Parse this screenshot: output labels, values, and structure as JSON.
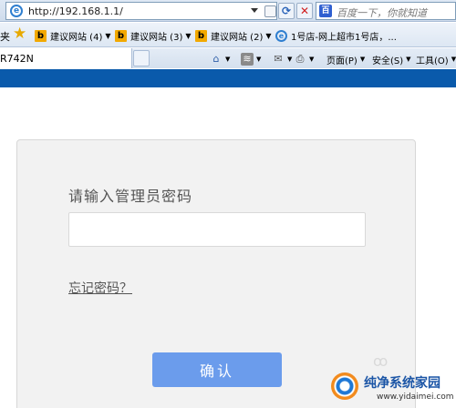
{
  "browser": {
    "address": "http://192.168.1.1/",
    "search_placeholder": "百度一下，你就知道",
    "favorites_cut_text": "夹",
    "favorites": [
      {
        "label": "建议网站 (4)",
        "icon": "b-icon"
      },
      {
        "label": "建议网站 (3)",
        "icon": "b-icon"
      },
      {
        "label": "建议网站 (2)",
        "icon": "b-icon"
      },
      {
        "label": "1号店-网上超市1号店，...",
        "icon": "ie-icon"
      }
    ],
    "tab_label": "R742N",
    "commands": {
      "page": "页面(P)",
      "safety": "安全(S)",
      "tools": "工具(O)"
    }
  },
  "login": {
    "title": "请输入管理员密码",
    "password_value": "",
    "forgot_label": "忘记密码？",
    "confirm_label": "确认"
  },
  "watermark": {
    "title": "纯净系统家园",
    "url": "www.yidaimei.com"
  },
  "colors": {
    "banner": "#0a5aab",
    "button": "#6b9cec",
    "card_bg": "#f2f2f2"
  }
}
